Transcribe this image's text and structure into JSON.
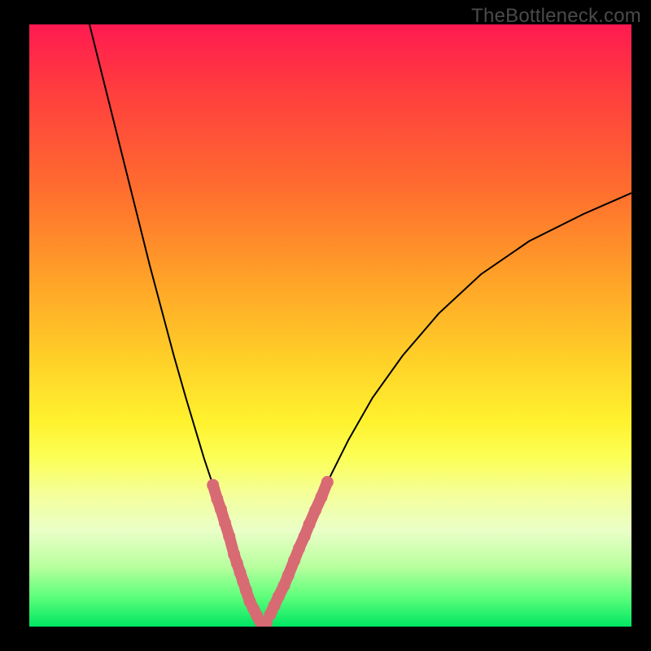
{
  "watermark": "TheBottleneck.com",
  "colors": {
    "background": "#000000",
    "dot_band": "#d86a74",
    "curve": "#000000",
    "gradient_top": "#ff1a51",
    "gradient_mid": "#fff22e",
    "gradient_bottom": "#00e663"
  },
  "chart_data": {
    "type": "line",
    "title": "",
    "xlabel": "",
    "ylabel": "",
    "xlim": [
      0,
      100
    ],
    "ylim": [
      0,
      100
    ],
    "grid": false,
    "series": [
      {
        "name": "left_curve",
        "x": [
          10.0,
          12.0,
          14.0,
          16.0,
          18.0,
          20.0,
          22.0,
          24.0,
          26.0,
          27.5,
          29.0,
          30.5,
          32.0,
          33.0,
          34.0,
          35.0,
          35.8,
          36.5,
          37.2,
          37.8,
          38.3,
          38.7
        ],
        "values": [
          100.0,
          92.0,
          84.0,
          76.0,
          68.0,
          60.0,
          52.5,
          45.0,
          38.0,
          33.0,
          28.0,
          23.5,
          19.0,
          15.5,
          12.0,
          9.0,
          6.5,
          4.5,
          3.0,
          1.8,
          0.9,
          0.3
        ]
      },
      {
        "name": "right_curve",
        "x": [
          38.7,
          40.0,
          42.0,
          44.0,
          46.5,
          49.5,
          53.0,
          57.0,
          62.0,
          68.0,
          75.0,
          83.0,
          92.0,
          100.0
        ],
        "values": [
          0.3,
          2.0,
          6.0,
          11.0,
          17.0,
          24.0,
          31.0,
          38.0,
          45.0,
          52.0,
          58.5,
          64.0,
          68.5,
          72.0
        ]
      }
    ],
    "markers": {
      "name": "dot_band",
      "description": "salmon rounded segments near bottom on both branches",
      "left_branch": [
        {
          "x": 30.5,
          "y": 23.5
        },
        {
          "x": 31.2,
          "y": 21.2
        },
        {
          "x": 31.8,
          "y": 19.5
        },
        {
          "x": 32.5,
          "y": 17.2
        },
        {
          "x": 33.2,
          "y": 15.0
        },
        {
          "x": 34.0,
          "y": 12.0
        },
        {
          "x": 34.5,
          "y": 10.5
        },
        {
          "x": 35.0,
          "y": 9.0
        },
        {
          "x": 35.5,
          "y": 7.5
        },
        {
          "x": 36.0,
          "y": 6.0
        },
        {
          "x": 36.6,
          "y": 4.2
        },
        {
          "x": 37.2,
          "y": 3.0
        },
        {
          "x": 37.8,
          "y": 1.8
        },
        {
          "x": 38.3,
          "y": 0.9
        }
      ],
      "bottom": [
        {
          "x": 38.7,
          "y": 0.3
        },
        {
          "x": 39.4,
          "y": 0.7
        }
      ],
      "right_branch": [
        {
          "x": 40.0,
          "y": 2.0
        },
        {
          "x": 40.7,
          "y": 3.5
        },
        {
          "x": 41.4,
          "y": 5.0
        },
        {
          "x": 42.3,
          "y": 6.8
        },
        {
          "x": 43.0,
          "y": 8.5
        },
        {
          "x": 44.0,
          "y": 11.0
        },
        {
          "x": 44.8,
          "y": 13.0
        },
        {
          "x": 45.7,
          "y": 15.0
        },
        {
          "x": 46.5,
          "y": 17.0
        },
        {
          "x": 47.5,
          "y": 19.3
        },
        {
          "x": 48.5,
          "y": 21.5
        },
        {
          "x": 49.5,
          "y": 24.0
        }
      ]
    }
  }
}
